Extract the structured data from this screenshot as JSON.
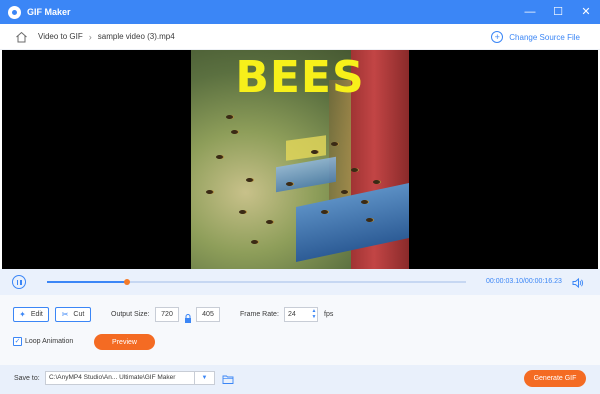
{
  "window": {
    "title": "GIF Maker",
    "minimize": "—",
    "maximize": "☐",
    "close": "✕"
  },
  "nav": {
    "breadcrumb": [
      "Video to GIF",
      "sample video (3).mp4"
    ],
    "separator": "›",
    "change_source": "Change Source File"
  },
  "video": {
    "overlay_text": "BEES"
  },
  "playback": {
    "current_time": "00:00:03.10",
    "total_time": "00:00:16.23",
    "time_display": "00:00:03.10/00:00:16.23",
    "progress": 0.19
  },
  "settings": {
    "edit_label": "Edit",
    "cut_label": "Cut",
    "output_size_label": "Output Size:",
    "width": "720",
    "height": "405",
    "frame_rate_label": "Frame Rate:",
    "frame_rate": "24",
    "fps_unit": "fps",
    "loop_label": "Loop Animation",
    "loop_checked": true,
    "preview_label": "Preview"
  },
  "footer": {
    "save_to_label": "Save to:",
    "save_path": "C:\\AnyMP4 Studio\\An... Ultimate\\GIF Maker",
    "generate_label": "Generate GIF"
  },
  "colors": {
    "accent": "#3b86f6",
    "orange": "#f46b23",
    "overlay_text": "#f7f01a"
  }
}
